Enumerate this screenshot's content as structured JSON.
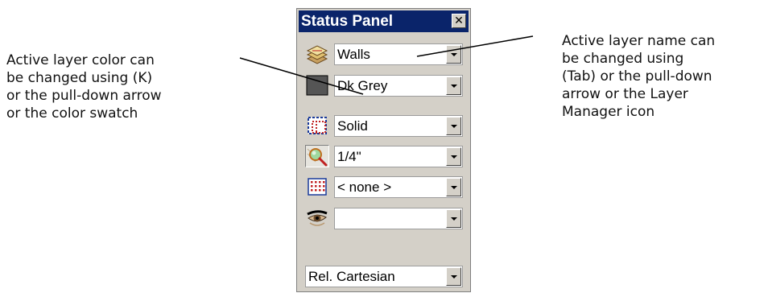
{
  "callouts": {
    "left": [
      "Active layer color can",
      "be changed using (K)",
      "or the pull-down arrow",
      "or the color swatch"
    ],
    "right": [
      "Active layer name can",
      "be changed using",
      "(Tab) or the pull-down",
      "arrow or the Layer",
      "Manager icon"
    ]
  },
  "panel": {
    "title": "Status Panel",
    "close_glyph": "✕",
    "rows": [
      {
        "icon": "layer-manager-icon",
        "value": "Walls"
      },
      {
        "icon": "color-swatch-icon",
        "value": "Dk Grey",
        "swatch_color": "#555555"
      },
      {
        "icon": "line-style-icon",
        "value": "Solid"
      },
      {
        "icon": "zoom-scale-icon",
        "value": "1/4\""
      },
      {
        "icon": "grid-snap-icon",
        "value": "< none >"
      },
      {
        "icon": "eye-icon",
        "value": ""
      }
    ],
    "coordinate_mode": "Rel. Cartesian"
  },
  "colors": {
    "titlebar": "#0a246a",
    "panel_bg": "#d4d0c8"
  }
}
